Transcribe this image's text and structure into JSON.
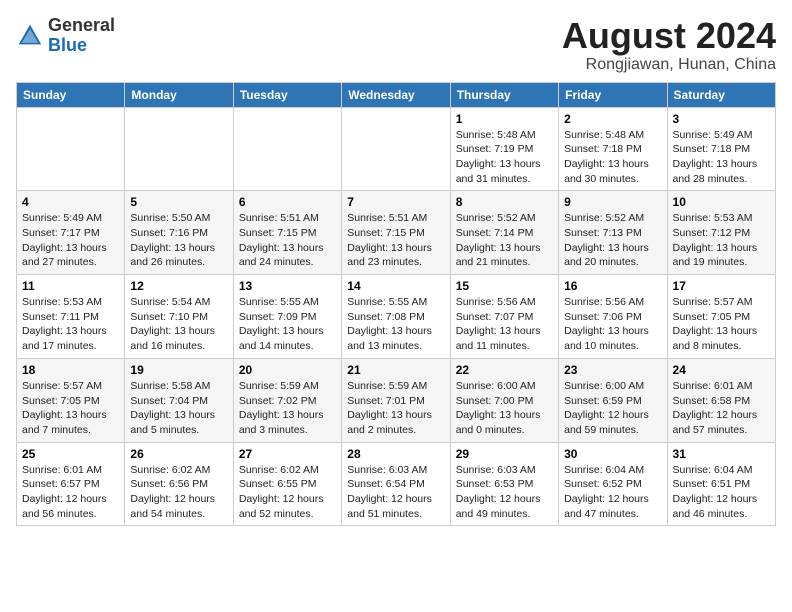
{
  "header": {
    "logo_line1": "General",
    "logo_line2": "Blue",
    "month": "August 2024",
    "location": "Rongjiawan, Hunan, China"
  },
  "days_of_week": [
    "Sunday",
    "Monday",
    "Tuesday",
    "Wednesday",
    "Thursday",
    "Friday",
    "Saturday"
  ],
  "weeks": [
    [
      {
        "day": "",
        "info": ""
      },
      {
        "day": "",
        "info": ""
      },
      {
        "day": "",
        "info": ""
      },
      {
        "day": "",
        "info": ""
      },
      {
        "day": "1",
        "info": "Sunrise: 5:48 AM\nSunset: 7:19 PM\nDaylight: 13 hours\nand 31 minutes."
      },
      {
        "day": "2",
        "info": "Sunrise: 5:48 AM\nSunset: 7:18 PM\nDaylight: 13 hours\nand 30 minutes."
      },
      {
        "day": "3",
        "info": "Sunrise: 5:49 AM\nSunset: 7:18 PM\nDaylight: 13 hours\nand 28 minutes."
      }
    ],
    [
      {
        "day": "4",
        "info": "Sunrise: 5:49 AM\nSunset: 7:17 PM\nDaylight: 13 hours\nand 27 minutes."
      },
      {
        "day": "5",
        "info": "Sunrise: 5:50 AM\nSunset: 7:16 PM\nDaylight: 13 hours\nand 26 minutes."
      },
      {
        "day": "6",
        "info": "Sunrise: 5:51 AM\nSunset: 7:15 PM\nDaylight: 13 hours\nand 24 minutes."
      },
      {
        "day": "7",
        "info": "Sunrise: 5:51 AM\nSunset: 7:15 PM\nDaylight: 13 hours\nand 23 minutes."
      },
      {
        "day": "8",
        "info": "Sunrise: 5:52 AM\nSunset: 7:14 PM\nDaylight: 13 hours\nand 21 minutes."
      },
      {
        "day": "9",
        "info": "Sunrise: 5:52 AM\nSunset: 7:13 PM\nDaylight: 13 hours\nand 20 minutes."
      },
      {
        "day": "10",
        "info": "Sunrise: 5:53 AM\nSunset: 7:12 PM\nDaylight: 13 hours\nand 19 minutes."
      }
    ],
    [
      {
        "day": "11",
        "info": "Sunrise: 5:53 AM\nSunset: 7:11 PM\nDaylight: 13 hours\nand 17 minutes."
      },
      {
        "day": "12",
        "info": "Sunrise: 5:54 AM\nSunset: 7:10 PM\nDaylight: 13 hours\nand 16 minutes."
      },
      {
        "day": "13",
        "info": "Sunrise: 5:55 AM\nSunset: 7:09 PM\nDaylight: 13 hours\nand 14 minutes."
      },
      {
        "day": "14",
        "info": "Sunrise: 5:55 AM\nSunset: 7:08 PM\nDaylight: 13 hours\nand 13 minutes."
      },
      {
        "day": "15",
        "info": "Sunrise: 5:56 AM\nSunset: 7:07 PM\nDaylight: 13 hours\nand 11 minutes."
      },
      {
        "day": "16",
        "info": "Sunrise: 5:56 AM\nSunset: 7:06 PM\nDaylight: 13 hours\nand 10 minutes."
      },
      {
        "day": "17",
        "info": "Sunrise: 5:57 AM\nSunset: 7:05 PM\nDaylight: 13 hours\nand 8 minutes."
      }
    ],
    [
      {
        "day": "18",
        "info": "Sunrise: 5:57 AM\nSunset: 7:05 PM\nDaylight: 13 hours\nand 7 minutes."
      },
      {
        "day": "19",
        "info": "Sunrise: 5:58 AM\nSunset: 7:04 PM\nDaylight: 13 hours\nand 5 minutes."
      },
      {
        "day": "20",
        "info": "Sunrise: 5:59 AM\nSunset: 7:02 PM\nDaylight: 13 hours\nand 3 minutes."
      },
      {
        "day": "21",
        "info": "Sunrise: 5:59 AM\nSunset: 7:01 PM\nDaylight: 13 hours\nand 2 minutes."
      },
      {
        "day": "22",
        "info": "Sunrise: 6:00 AM\nSunset: 7:00 PM\nDaylight: 13 hours\nand 0 minutes."
      },
      {
        "day": "23",
        "info": "Sunrise: 6:00 AM\nSunset: 6:59 PM\nDaylight: 12 hours\nand 59 minutes."
      },
      {
        "day": "24",
        "info": "Sunrise: 6:01 AM\nSunset: 6:58 PM\nDaylight: 12 hours\nand 57 minutes."
      }
    ],
    [
      {
        "day": "25",
        "info": "Sunrise: 6:01 AM\nSunset: 6:57 PM\nDaylight: 12 hours\nand 56 minutes."
      },
      {
        "day": "26",
        "info": "Sunrise: 6:02 AM\nSunset: 6:56 PM\nDaylight: 12 hours\nand 54 minutes."
      },
      {
        "day": "27",
        "info": "Sunrise: 6:02 AM\nSunset: 6:55 PM\nDaylight: 12 hours\nand 52 minutes."
      },
      {
        "day": "28",
        "info": "Sunrise: 6:03 AM\nSunset: 6:54 PM\nDaylight: 12 hours\nand 51 minutes."
      },
      {
        "day": "29",
        "info": "Sunrise: 6:03 AM\nSunset: 6:53 PM\nDaylight: 12 hours\nand 49 minutes."
      },
      {
        "day": "30",
        "info": "Sunrise: 6:04 AM\nSunset: 6:52 PM\nDaylight: 12 hours\nand 47 minutes."
      },
      {
        "day": "31",
        "info": "Sunrise: 6:04 AM\nSunset: 6:51 PM\nDaylight: 12 hours\nand 46 minutes."
      }
    ]
  ]
}
